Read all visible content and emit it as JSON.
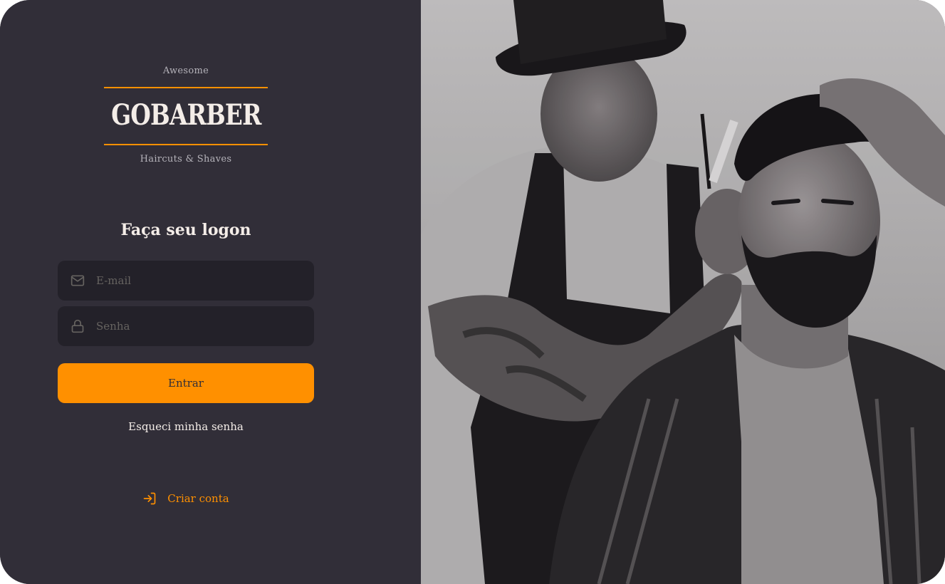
{
  "logo": {
    "top_text": "Awesome",
    "brand": "GOBARBER",
    "bottom_text": "Haircuts & Shaves"
  },
  "form": {
    "title": "Faça seu logon",
    "email": {
      "placeholder": "E-mail",
      "value": "",
      "icon": "mail-icon"
    },
    "password": {
      "placeholder": "Senha",
      "value": "",
      "icon": "lock-icon"
    },
    "submit_label": "Entrar",
    "forgot_label": "Esqueci minha senha"
  },
  "footer": {
    "create_account_label": "Criar conta",
    "icon": "log-in-icon"
  },
  "colors": {
    "background": "#312e38",
    "input_background": "#232129",
    "accent": "#ff9000",
    "text": "#f4ede8",
    "muted": "#666360"
  }
}
